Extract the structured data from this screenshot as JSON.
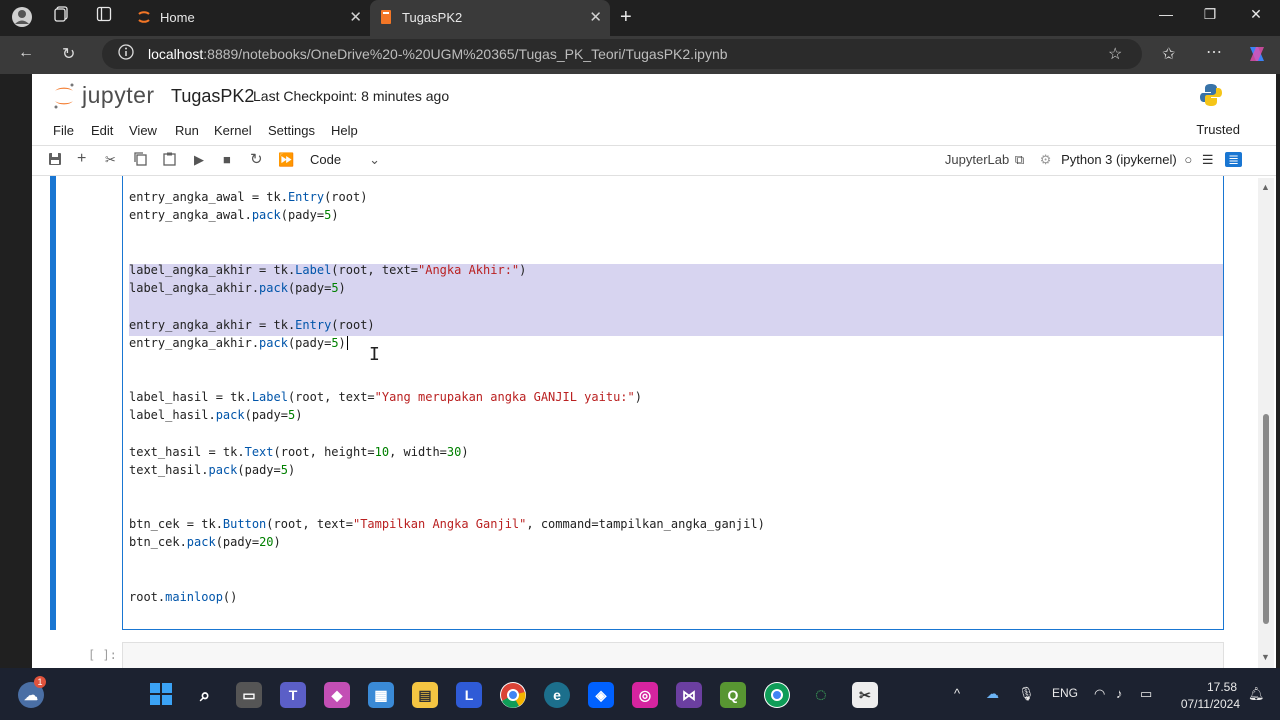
{
  "browser": {
    "tabs": [
      {
        "label": "Home"
      },
      {
        "label": "TugasPK2"
      }
    ],
    "url_host": "localhost",
    "url_rest": ":8889/notebooks/OneDrive%20-%20UGM%20365/Tugas_PK_Teori/TugasPK2.ipynb"
  },
  "jupyter": {
    "logo": "jupyter",
    "notebook_title": "TugasPK2",
    "checkpoint": "Last Checkpoint: 8 minutes ago",
    "menu": [
      "File",
      "Edit",
      "View",
      "Run",
      "Kernel",
      "Settings",
      "Help"
    ],
    "trusted": "Trusted",
    "cell_type": "Code",
    "jupyterlab_link": "JupyterLab",
    "kernel": "Python 3 (ipykernel)"
  },
  "code": {
    "line1a": "entry_angka_awal = tk.",
    "line1b": "Entry",
    "line1c": "(root)",
    "line2a": "entry_angka_awal.",
    "line2b": "pack",
    "line2c": "(pady=",
    "line2d": "5",
    "line2e": ")",
    "line3a": "label_angka_akhir = tk.",
    "line3b": "Label",
    "line3c": "(root, text=",
    "line3d": "\"Angka Akhir:\"",
    "line3e": ")",
    "line4a": "label_angka_akhir.",
    "line4b": "pack",
    "line4c": "(pady=",
    "line4d": "5",
    "line4e": ")",
    "line5a": "entry_angka_akhir = tk.",
    "line5b": "Entry",
    "line5c": "(root)",
    "line6a": "entry_angka_akhir.",
    "line6b": "pack",
    "line6c": "(pady=",
    "line6d": "5",
    "line6e": ")",
    "line7a": "label_hasil = tk.",
    "line7b": "Label",
    "line7c": "(root, text=",
    "line7d": "\"Yang merupakan angka GANJIL yaitu:\"",
    "line7e": ")",
    "line8a": "label_hasil.",
    "line8b": "pack",
    "line8c": "(pady=",
    "line8d": "5",
    "line8e": ")",
    "line9a": "text_hasil = tk.",
    "line9b": "Text",
    "line9c": "(root, height=",
    "line9d": "10",
    "line9e": ", width=",
    "line9f": "30",
    "line9g": ")",
    "line10a": "text_hasil.",
    "line10b": "pack",
    "line10c": "(pady=",
    "line10d": "5",
    "line10e": ")",
    "line11a": "btn_cek = tk.",
    "line11b": "Button",
    "line11c": "(root, text=",
    "line11d": "\"Tampilkan Angka Ganjil\"",
    "line11e": ", command=tampilkan_angka_ganjil)",
    "line12a": "btn_cek.",
    "line12b": "pack",
    "line12c": "(pady=",
    "line12d": "20",
    "line12e": ")",
    "line13a": "root.",
    "line13b": "mainloop",
    "line13c": "()",
    "next_prompt": "[ ]:"
  },
  "taskbar": {
    "badge": "1",
    "lang": "ENG",
    "time": "17.58",
    "date": "07/11/2024"
  }
}
